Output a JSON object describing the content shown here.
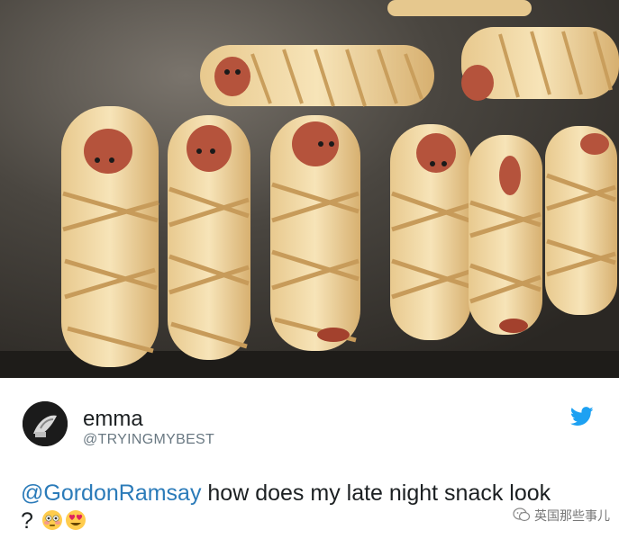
{
  "tweet": {
    "user_name": "emma",
    "user_handle": "@TRYINGMYBEST",
    "mention": "@GordonRamsay",
    "text_after_mention": " how does my late night snack look",
    "text_line2": "?"
  },
  "icons": {
    "bird": "twitter-bird-icon",
    "emoji_1": "flushed-face-emoji",
    "emoji_2": "heart-eyes-emoji",
    "watermark_icon": "wechat-icon"
  },
  "watermark": {
    "text": "英国那些事儿"
  },
  "colors": {
    "twitter_blue": "#1da1f2",
    "mention_blue": "#2b7bb9",
    "text_dark": "#1c2022",
    "text_gray": "#697882"
  }
}
